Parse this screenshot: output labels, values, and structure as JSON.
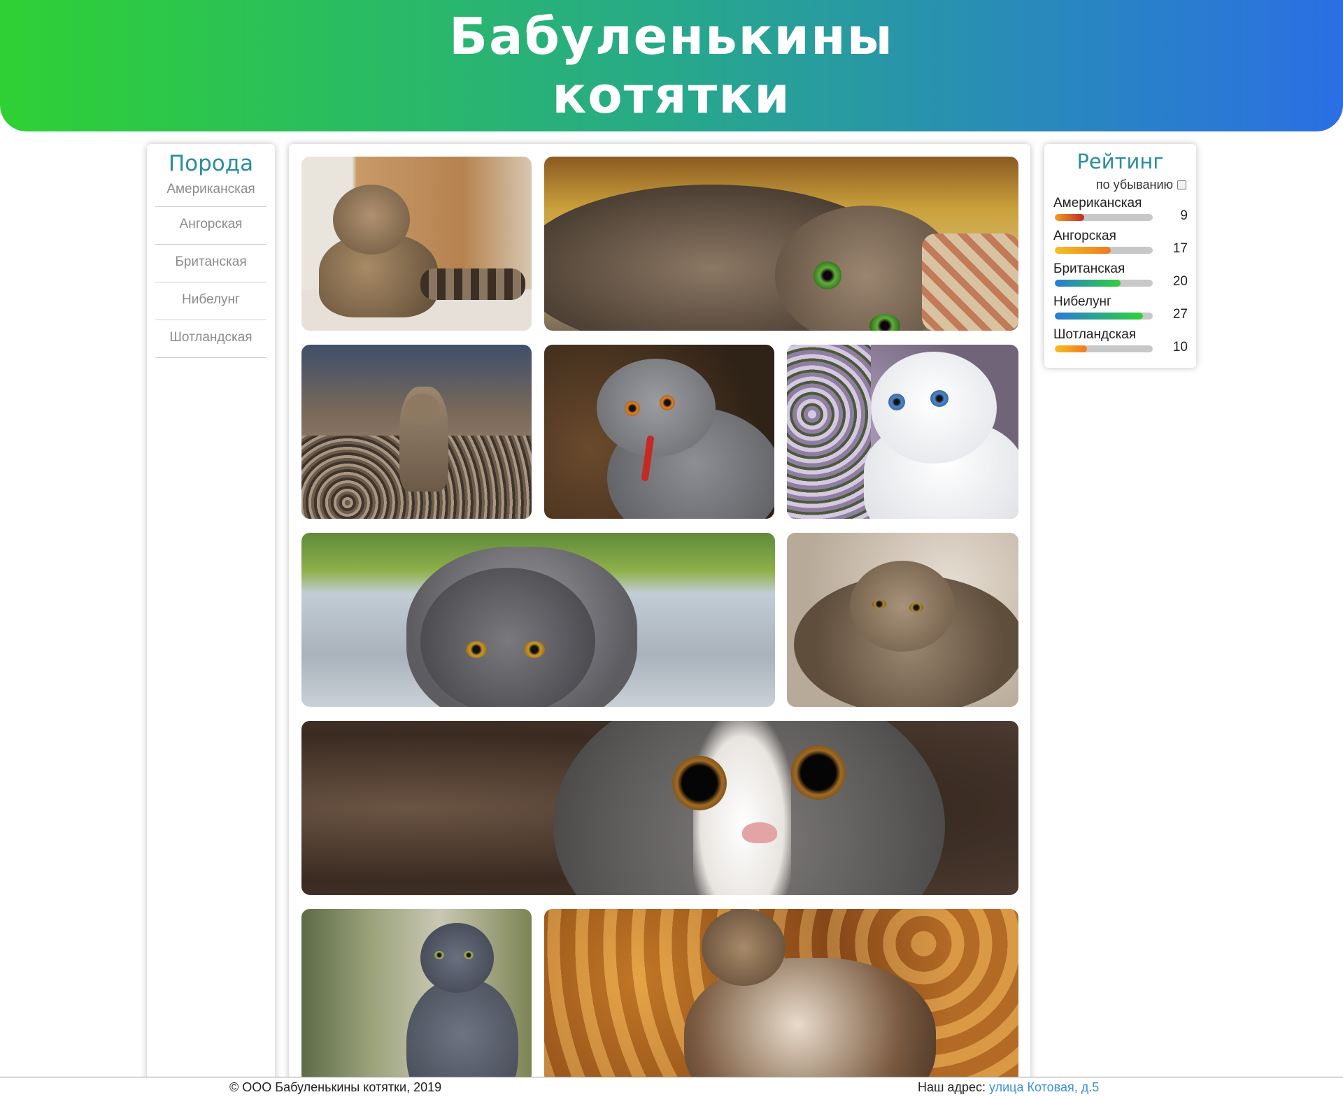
{
  "header": {
    "title": "Бабуленькины котятки"
  },
  "sidebar": {
    "title": "Порода",
    "items": [
      {
        "label": "Американская"
      },
      {
        "label": "Ангорская"
      },
      {
        "label": "Британская"
      },
      {
        "label": "Нибелунг"
      },
      {
        "label": "Шотландская"
      }
    ]
  },
  "gallery": {
    "photos": [
      {
        "name": "cat-photo-tabby-sitting"
      },
      {
        "name": "cat-photo-tabby-lying-green-eyes"
      },
      {
        "name": "cat-photo-tabby-walking"
      },
      {
        "name": "cat-photo-grey-british-stick"
      },
      {
        "name": "cat-photo-white-blue-eyes"
      },
      {
        "name": "cat-photo-grey-crouching"
      },
      {
        "name": "cat-photo-tabby-on-back"
      },
      {
        "name": "cat-photo-grey-white-closeup"
      },
      {
        "name": "cat-photo-blue-nebelung"
      },
      {
        "name": "cat-photo-fluffy-tabby-autumn"
      }
    ]
  },
  "rating": {
    "title": "Рейтинг",
    "sort_label": "по убыванию",
    "sort_checked": false,
    "items": [
      {
        "label": "Американская",
        "value": "9",
        "fraction": 0.3,
        "gradient": [
          "#f0a020",
          "#c0282a"
        ]
      },
      {
        "label": "Ангорская",
        "value": "17",
        "fraction": 0.57,
        "gradient": [
          "#f5c020",
          "#f07a20"
        ]
      },
      {
        "label": "Британская",
        "value": "20",
        "fraction": 0.67,
        "gradient": [
          "#2a7ad8",
          "#2ed13a"
        ]
      },
      {
        "label": "Нибелунг",
        "value": "27",
        "fraction": 0.9,
        "gradient": [
          "#2a7ad8",
          "#2ed13a"
        ]
      },
      {
        "label": "Шотландская",
        "value": "10",
        "fraction": 0.33,
        "gradient": [
          "#f5c020",
          "#f07a20"
        ]
      }
    ]
  },
  "footer": {
    "copyright": "© ООО Бабуленькины котятки, 2019",
    "address_label": "Наш адрес:",
    "address_link": "улица Котовая, д.5"
  },
  "colors": {
    "header_gradient_start": "#2ed134",
    "header_gradient_end": "#2a6fe4",
    "accent_title": "#2a8e9c",
    "link": "#3a8ed8"
  }
}
